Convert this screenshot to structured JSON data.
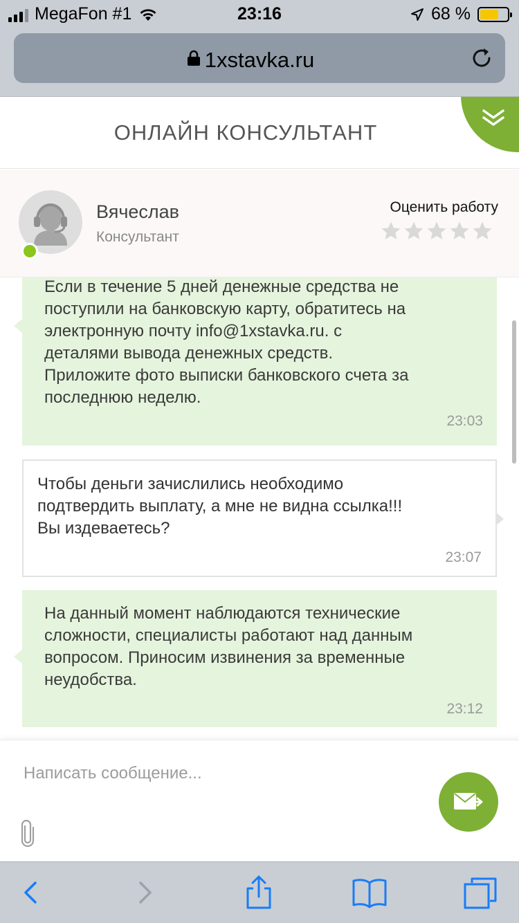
{
  "status_bar": {
    "carrier": "MegaFon #1",
    "time": "23:16",
    "battery_percent": "68 %",
    "battery_level": 0.68,
    "icons": [
      "signal-icon",
      "wifi-icon",
      "location-arrow-icon",
      "battery-icon"
    ]
  },
  "browser": {
    "url": "1xstavka.ru",
    "icons": [
      "lock-icon",
      "reload-icon"
    ]
  },
  "chat": {
    "title": "ОНЛАЙН КОНСУЛЬТАНТ",
    "collapse_icon": "double-chevron-down-icon"
  },
  "consultant": {
    "name": "Вячеслав",
    "role": "Консультант",
    "rate_label": "Оценить работу",
    "rating": 0,
    "stars_total": 5,
    "online_color": "#8bc51d"
  },
  "messages": [
    {
      "from": "agent",
      "lines": [
        "Если в течение 5 дней денежные средства не",
        "поступили на банковскую карту, обратитесь на",
        "электронную почту info@1xstavka.ru. с",
        "деталями вывода денежных средств.",
        "Приложите фото выписки банковского счета за",
        "последнюю неделю."
      ],
      "time": "23:03"
    },
    {
      "from": "user",
      "lines": [
        "Чтобы деньги зачислились необходимо",
        "подтвердить выплату, а мне не видна ссылка!!!",
        "Вы издеваетесь?"
      ],
      "time": "23:07"
    },
    {
      "from": "agent",
      "lines": [
        "На данный момент наблюдаются технические",
        "сложности, специалисты работают над данным",
        "вопросом. Приносим извинения за временные",
        "неудобства."
      ],
      "time": "23:12"
    }
  ],
  "compose": {
    "placeholder": "Написать сообщение...",
    "attach_icon": "paperclip-icon",
    "send_icon": "envelope-send-icon"
  },
  "toolbar": {
    "icons": [
      "back-icon",
      "forward-icon",
      "share-icon",
      "bookmarks-icon",
      "tabs-icon"
    ]
  },
  "colors": {
    "accent": "#7db034",
    "agent_bubble": "#e5f4dd",
    "ios_blue": "#1a7cf5",
    "chrome_gray": "#c9ced4"
  }
}
